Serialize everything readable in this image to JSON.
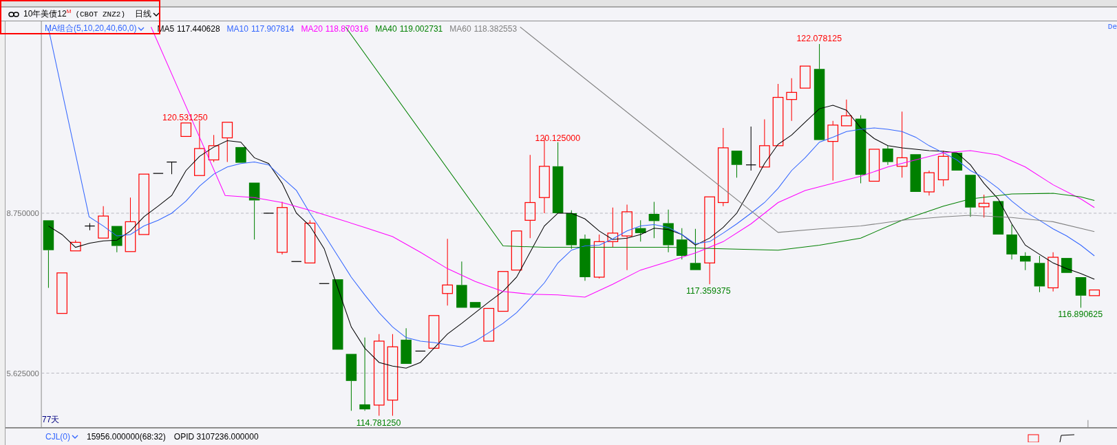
{
  "header": {
    "title": "10年美债12$^{M}$",
    "contract": "(CBOT ZNZ2)",
    "period": "日线"
  },
  "legend": {
    "group": "MA组合(5,10,20,40,60,0)",
    "items": [
      {
        "name": "MA5",
        "value": "117.440628",
        "color": "#000000"
      },
      {
        "name": "MA10",
        "value": "117.907814",
        "color": "#3366ff"
      },
      {
        "name": "MA20",
        "value": "118.870316",
        "color": "#ff00ff"
      },
      {
        "name": "MA40",
        "value": "119.002731",
        "color": "#008000"
      },
      {
        "name": "MA60",
        "value": "118.382553",
        "color": "#808080"
      }
    ]
  },
  "corner_label": "De",
  "y_axis": {
    "labels": [
      "8.750000",
      "5.625000"
    ]
  },
  "price_labels": [
    {
      "text": "120.531250",
      "kind": "high"
    },
    {
      "text": "120.125000",
      "kind": "high"
    },
    {
      "text": "122.078125",
      "kind": "high"
    },
    {
      "text": "117.359375",
      "kind": "low"
    },
    {
      "text": "116.890625",
      "kind": "low"
    },
    {
      "text": "114.781250",
      "kind": "low"
    }
  ],
  "range_label": "77天",
  "indicator": {
    "name": "CJL(0)",
    "reading": "15956.000000(68:32)",
    "opid": "OPID 3107236.000000"
  }
}
